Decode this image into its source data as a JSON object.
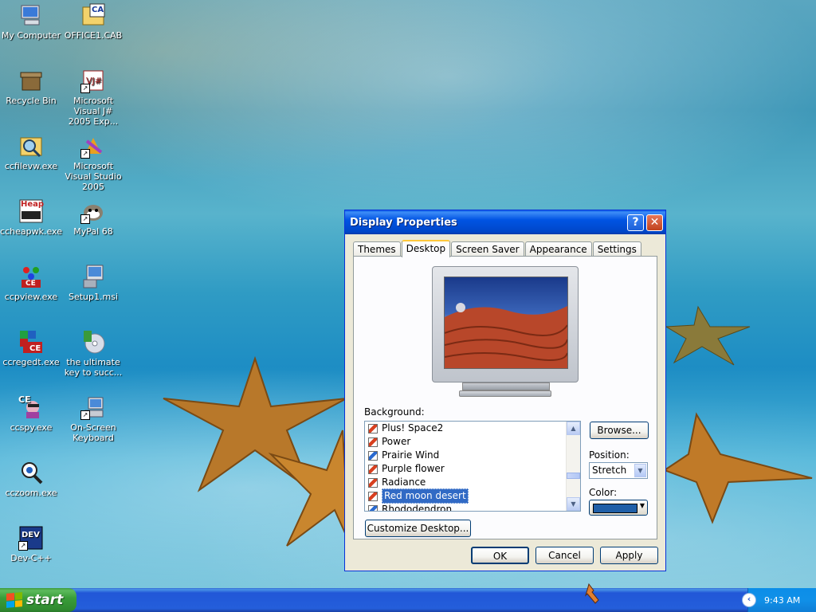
{
  "desktop": {
    "icons": [
      {
        "label": "My Computer"
      },
      {
        "label": "OFFICE1.CAB"
      },
      {
        "label": "Recycle Bin"
      },
      {
        "label": "Microsoft Visual J# 2005 Exp..."
      },
      {
        "label": "ccfilevw.exe"
      },
      {
        "label": "Microsoft Visual Studio 2005"
      },
      {
        "label": "ccheapwk.exe"
      },
      {
        "label": "MyPal 68"
      },
      {
        "label": "ccpview.exe"
      },
      {
        "label": "Setup1.msi"
      },
      {
        "label": "ccregedt.exe"
      },
      {
        "label": "the ultimate key to succ..."
      },
      {
        "label": "ccspy.exe"
      },
      {
        "label": "On-Screen Keyboard"
      },
      {
        "label": "cczoom.exe"
      },
      {
        "label": "Dev-C++"
      }
    ],
    "icon_text": {
      "office1": "CA",
      "heap": "Heap",
      "ccpview": "CE",
      "ccregedt": "CE",
      "ccspy": "CE",
      "dev": "DEV"
    }
  },
  "window": {
    "title": "Display Properties",
    "help_glyph": "?",
    "close_glyph": "✕",
    "tabs": [
      {
        "label": "Themes"
      },
      {
        "label": "Desktop"
      },
      {
        "label": "Screen Saver"
      },
      {
        "label": "Appearance"
      },
      {
        "label": "Settings"
      }
    ],
    "background_label": "Background:",
    "background_items": [
      {
        "label": "Plus! Space2"
      },
      {
        "label": "Power"
      },
      {
        "label": "Prairie Wind"
      },
      {
        "label": "Purple flower"
      },
      {
        "label": "Radiance"
      },
      {
        "label": "Red moon desert"
      },
      {
        "label": "Rhododendron"
      }
    ],
    "browse_label": "Browse...",
    "position_label": "Position:",
    "position_value": "Stretch",
    "color_label": "Color:",
    "color_value": "#1f5fa8",
    "customize_label": "Customize Desktop...",
    "ok_label": "OK",
    "cancel_label": "Cancel",
    "apply_label": "Apply"
  },
  "taskbar": {
    "start_label": "start",
    "clock": "9:43 AM",
    "tray_arrow": "‹"
  }
}
